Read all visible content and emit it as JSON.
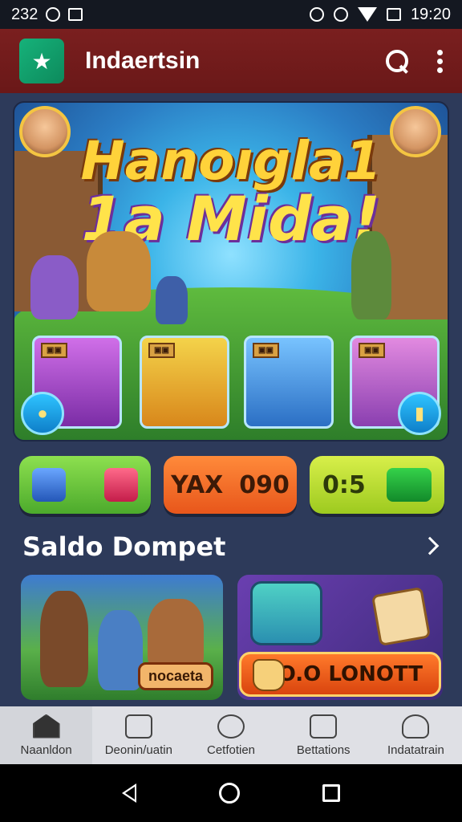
{
  "status_bar": {
    "time_left": "232",
    "time_right": "19:20"
  },
  "app_bar": {
    "title": "Indaertsin"
  },
  "hero": {
    "title_line1": "Hanoıgla1",
    "title_line2": "1a Mida!",
    "card_tags": [
      "▣▣",
      "▣▣",
      "▣▣",
      "▣▣"
    ]
  },
  "pills": {
    "orange_left": "YAX",
    "orange_right": "090",
    "lime_label": "0:5"
  },
  "section": {
    "title": "Saldo Dompet"
  },
  "promos": {
    "left_tag": "nocaeta",
    "right_cta": "EO.O LONOTT"
  },
  "bottom_nav": {
    "items": [
      {
        "label": "Naanldon",
        "icon": "home-icon"
      },
      {
        "label": "Deonin/uatin",
        "icon": "chest-icon"
      },
      {
        "label": "Cetfotien",
        "icon": "face-icon"
      },
      {
        "label": "Bettations",
        "icon": "puzzle-icon"
      },
      {
        "label": "Indatatrain",
        "icon": "user-icon"
      }
    ]
  },
  "colors": {
    "app_bar": "#7a1f1f",
    "background": "#2d3a5a",
    "accent_orange": "#e8561b",
    "accent_green": "#4caa2c"
  }
}
